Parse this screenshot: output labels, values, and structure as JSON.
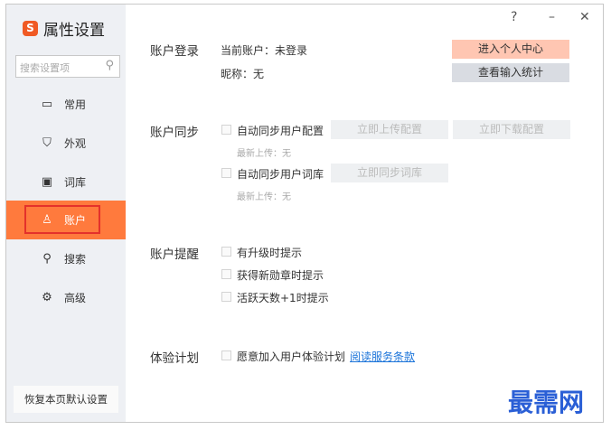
{
  "window": {
    "title": "属性设置",
    "help": "?",
    "minimize": "–",
    "close": "✕"
  },
  "sidebar": {
    "search_placeholder": "搜索设置项",
    "items": [
      {
        "label": "常用",
        "icon": "monitor-icon"
      },
      {
        "label": "外观",
        "icon": "shirt-icon"
      },
      {
        "label": "词库",
        "icon": "book-icon"
      },
      {
        "label": "账户",
        "icon": "user-icon",
        "active": true
      },
      {
        "label": "搜索",
        "icon": "search-icon"
      },
      {
        "label": "高级",
        "icon": "gear-icon"
      }
    ],
    "reset": "恢复本页默认设置"
  },
  "login": {
    "title": "账户登录",
    "current": "当前账户：未登录",
    "nickname": "昵称：无",
    "personal_center": "进入个人中心",
    "input_stats": "查看输入统计"
  },
  "sync": {
    "title": "账户同步",
    "config_label": "自动同步用户配置",
    "upload": "立即上传配置",
    "download": "立即下载配置",
    "config_last": "最新上传：无",
    "dict_label": "自动同步用户词库",
    "sync_dict": "立即同步词库",
    "dict_last": "最新上传：无"
  },
  "remind": {
    "title": "账户提醒",
    "items": [
      "有升级时提示",
      "获得新勋章时提示",
      "活跃天数+1时提示"
    ]
  },
  "experience": {
    "title": "体验计划",
    "label": "愿意加入用户体验计划",
    "link": "阅读服务条款"
  },
  "watermark": "最需网",
  "colors": {
    "accent": "#ff7a3d",
    "primary_button": "#ffc6b2"
  }
}
